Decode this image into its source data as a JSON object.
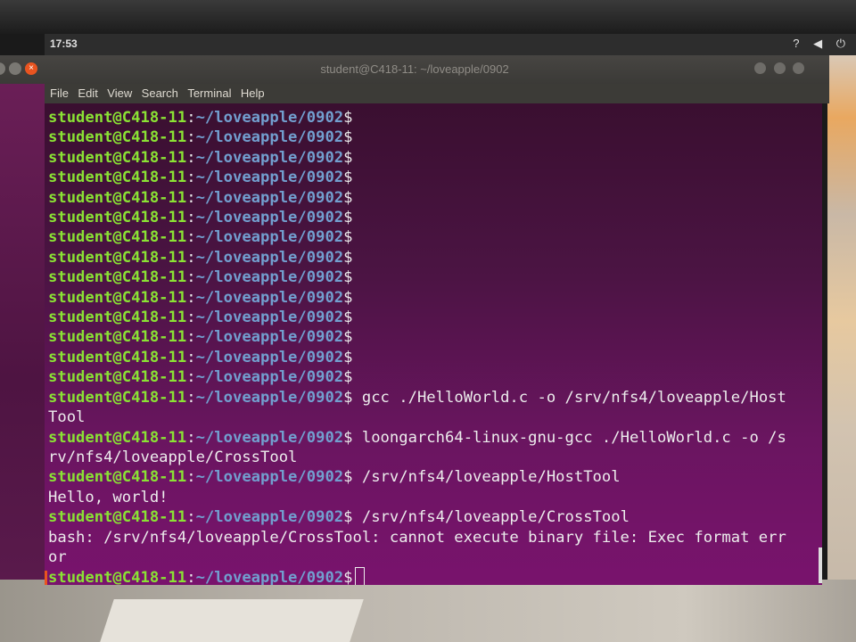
{
  "desktop": {
    "clock": "17:53",
    "tray": "? ◀ ⏻"
  },
  "window": {
    "title": "student@C418-11: ~/loveapple/0902",
    "close_glyph": "×"
  },
  "menu": [
    "File",
    "Edit",
    "View",
    "Search",
    "Terminal",
    "Help"
  ],
  "prompt": {
    "user": "student@C418-11",
    "sep": ":",
    "path": "~/loveapple/0902",
    "sym": "$"
  },
  "empty_prompts": 14,
  "commands": [
    {
      "cmd": " gcc ./HelloWorld.c -o /srv/nfs4/loveapple/Host",
      "cont": "Tool"
    },
    {
      "cmd": " loongarch64-linux-gnu-gcc ./HelloWorld.c -o /s",
      "cont": "rv/nfs4/loveapple/CrossTool"
    },
    {
      "cmd": " /srv/nfs4/loveapple/HostTool",
      "cont": "Hello, world!"
    },
    {
      "cmd": " /srv/nfs4/loveapple/CrossTool",
      "cont": "bash: /srv/nfs4/loveapple/CrossTool: cannot execute binary file: Exec format err",
      "cont2": "or"
    }
  ],
  "colors": {
    "user": "#8ae234",
    "path": "#729fcf",
    "text": "#ededed",
    "accent": "#e95420"
  }
}
